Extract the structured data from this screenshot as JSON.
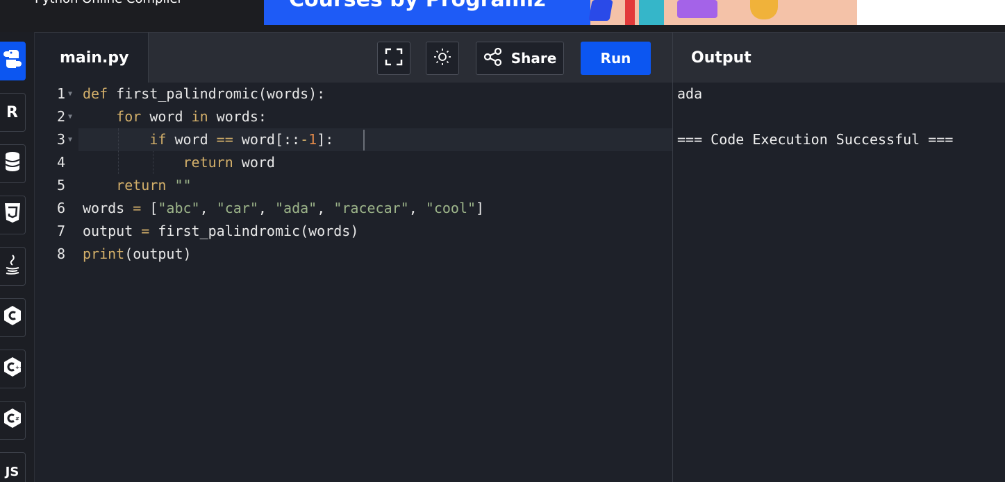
{
  "topbar": {
    "site_title": "Python Online Compiler",
    "banner_text": "Courses by Programiz"
  },
  "sidebar": {
    "languages": [
      {
        "name": "Python",
        "icon": "python-icon",
        "active": true
      },
      {
        "name": "R",
        "icon": "r-icon"
      },
      {
        "name": "SQL",
        "icon": "database-icon"
      },
      {
        "name": "HTML",
        "icon": "html5-icon"
      },
      {
        "name": "Java",
        "icon": "java-icon"
      },
      {
        "name": "C",
        "icon": "c-icon"
      },
      {
        "name": "C++",
        "icon": "cpp-icon"
      },
      {
        "name": "C#",
        "icon": "csharp-icon"
      },
      {
        "name": "JS",
        "icon": "js-icon",
        "label": "JS"
      }
    ]
  },
  "editor": {
    "file_tab": "main.py",
    "buttons": {
      "fullscreen_icon": "fullscreen-icon",
      "theme_icon": "sun-icon",
      "share_label": "Share",
      "share_icon": "share-icon",
      "run_label": "Run"
    },
    "line_numbers": [
      "1",
      "2",
      "3",
      "4",
      "5",
      "6",
      "7",
      "8"
    ]
  },
  "output": {
    "header": "Output",
    "lines": [
      "ada",
      "",
      "=== Code Execution Successful ==="
    ]
  },
  "colors": {
    "accent": "#0c56f1",
    "background": "#1e2129",
    "keyword": "#d4b06a",
    "string": "#9db58a",
    "number": "#e28a4a"
  }
}
